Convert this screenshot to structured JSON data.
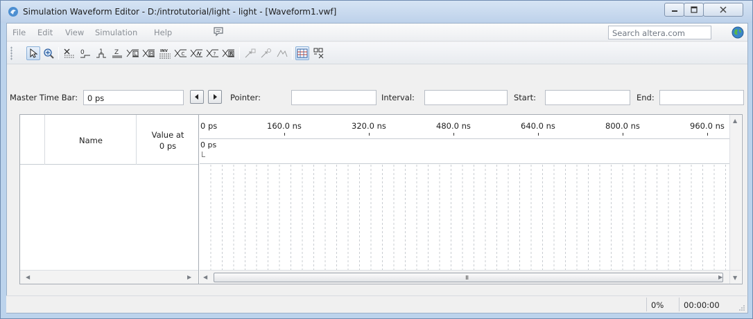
{
  "window": {
    "title": "Simulation Waveform Editor - D:/introtutorial/light - light - [Waveform1.vwf]"
  },
  "menu": {
    "items": [
      "File",
      "Edit",
      "View",
      "Simulation",
      "Help"
    ],
    "search_placeholder": "Search altera.com"
  },
  "toolbar": {
    "buttons": [
      {
        "name": "selection-tool",
        "glyph": "pointer",
        "active": true
      },
      {
        "name": "zoom-tool",
        "glyph": "zoom"
      },
      {
        "name": "forcing-unknown",
        "glyph": "X"
      },
      {
        "name": "forcing-low",
        "glyph": "0"
      },
      {
        "name": "forcing-high",
        "glyph": "1"
      },
      {
        "name": "high-impedance",
        "glyph": "Z"
      },
      {
        "name": "weak-low",
        "glyph": "L"
      },
      {
        "name": "weak-high",
        "glyph": "H"
      },
      {
        "name": "invert",
        "glyph": "INV"
      },
      {
        "name": "count-value",
        "glyph": "C"
      },
      {
        "name": "clock",
        "glyph": "clk"
      },
      {
        "name": "dont-care",
        "glyph": "?"
      },
      {
        "name": "random-values",
        "glyph": "R"
      },
      {
        "name": "snap-to-grid",
        "glyph": "snap"
      },
      {
        "name": "snap-to-grid-2",
        "glyph": "snap2"
      },
      {
        "name": "edit-waveform",
        "glyph": "edit"
      },
      {
        "name": "grid-view",
        "glyph": "grid",
        "active": true
      },
      {
        "name": "group-bus",
        "glyph": "bus"
      }
    ]
  },
  "timebar": {
    "master_label": "Master Time Bar:",
    "master_value": "0 ps",
    "pointer_label": "Pointer:",
    "pointer_value": "",
    "interval_label": "Interval:",
    "interval_value": "",
    "start_label": "Start:",
    "start_value": "",
    "end_label": "End:",
    "end_value": ""
  },
  "waveform": {
    "name_header": "Name",
    "value_header_line1": "Value at",
    "value_header_line2": "0 ps",
    "ruler_labels": [
      "0 ps",
      "160.0 ns",
      "320.0 ns",
      "480.0 ns",
      "640.0 ns",
      "800.0 ns",
      "960.0 ns"
    ],
    "cursor_label": "0 ps",
    "hscroll_grip": "III"
  },
  "status": {
    "progress": "0%",
    "elapsed": "00:00:00"
  },
  "colors": {
    "title_bar": "#bdd1ea",
    "active_button": "#c8dcf2",
    "grid_line": "#c8ccd1"
  }
}
